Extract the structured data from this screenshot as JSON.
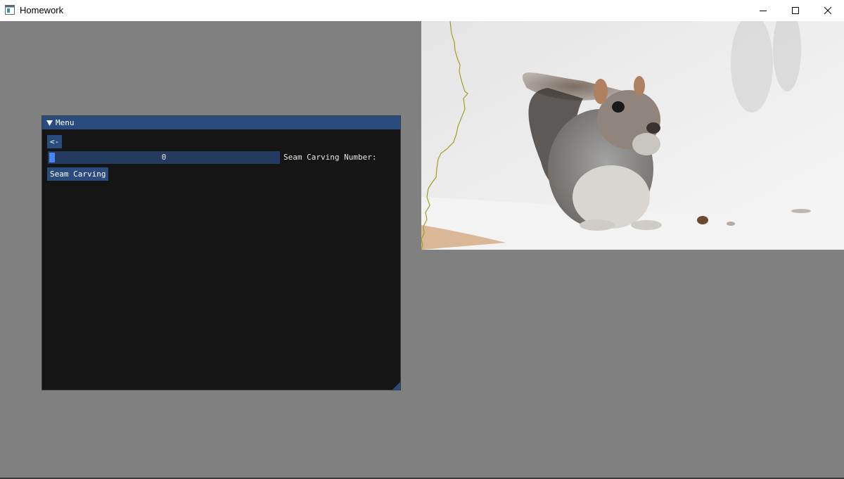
{
  "window": {
    "title": "Homework",
    "controls": [
      "minimize",
      "maximize",
      "close"
    ]
  },
  "menu": {
    "title": "Menu",
    "collapse_icon": "triangle-down-icon",
    "back_button_label": "<-",
    "slider": {
      "label": "Seam Carving Number:",
      "value": "0"
    },
    "seam_carving_button_label": "Seam Carving"
  },
  "image": {
    "subject": "squirrel-in-snow-photo",
    "seam_color": "#a0a020"
  },
  "colors": {
    "background": "#808080",
    "window_bg": "#151515",
    "accent": "#2a4b7e",
    "slider_bg": "#243a5e",
    "slider_grab": "#4287f5"
  }
}
